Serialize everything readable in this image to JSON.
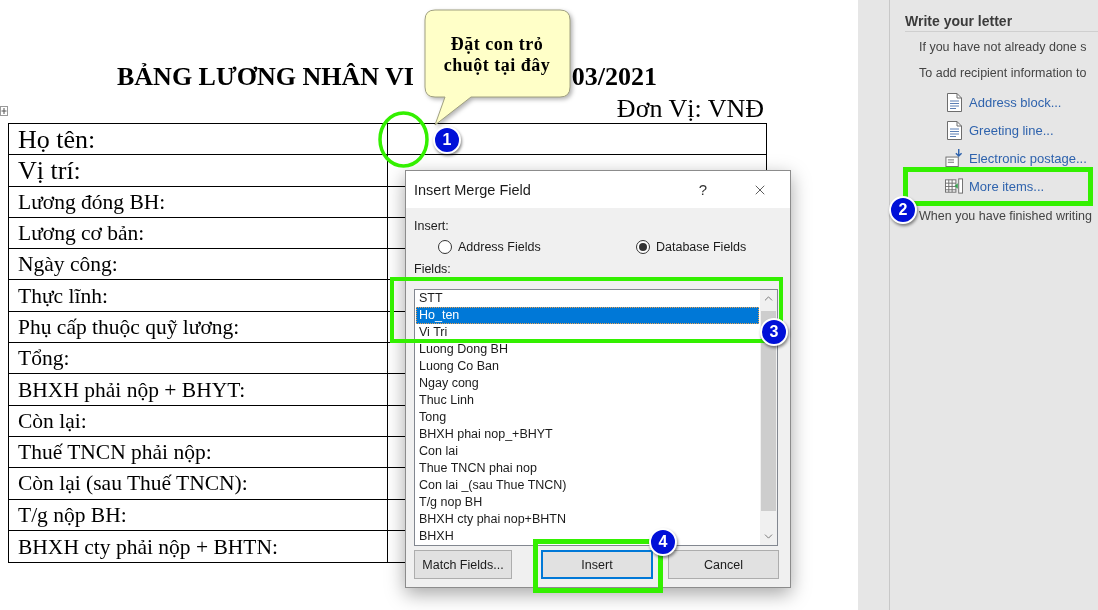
{
  "document": {
    "title_parts": [
      "BẢNG LƯƠNG NHÂN VI",
      "03/2021"
    ],
    "unit": "Đơn Vị: VNĐ",
    "rows": [
      {
        "label": "Họ tên:",
        "kind": "large"
      },
      {
        "label": "Vị trí:",
        "kind": "large"
      },
      {
        "label": "Lương đóng BH:",
        "kind": "normal"
      },
      {
        "label": "Lương cơ bản:",
        "kind": "normal"
      },
      {
        "label": "Ngày công:",
        "kind": "normal"
      },
      {
        "label": "Thực lĩnh:",
        "kind": "normal"
      },
      {
        "label": "Phụ cấp thuộc quỹ lương:",
        "kind": "normal"
      },
      {
        "label": "Tổng:",
        "kind": "normal"
      },
      {
        "label": "BHXH phải nộp + BHYT:",
        "kind": "normal"
      },
      {
        "label": "Còn lại:",
        "kind": "normal"
      },
      {
        "label": "Thuế TNCN phải nộp:",
        "kind": "normal"
      },
      {
        "label": "Còn lại (sau Thuế TNCN):",
        "kind": "normal"
      },
      {
        "label": "T/g nộp BH:",
        "kind": "normal"
      },
      {
        "label": "BHXH cty phải nộp + BHTN:",
        "kind": "normal"
      }
    ]
  },
  "callout": {
    "text": "Đặt con trỏ chuột tại đây"
  },
  "dialog": {
    "title": "Insert Merge Field",
    "help": "?",
    "insert_label": "Insert:",
    "insert_options": [
      {
        "label": "Address Fields",
        "selected": false
      },
      {
        "label": "Database Fields",
        "selected": true
      }
    ],
    "fields_label": "Fields:",
    "fields": [
      {
        "label": "STT",
        "selected": false
      },
      {
        "label": "Ho_ten",
        "selected": true
      },
      {
        "label": "Vi Tri",
        "selected": false
      },
      {
        "label": "Luong Dong BH",
        "selected": false
      },
      {
        "label": "Luong Co Ban",
        "selected": false
      },
      {
        "label": "Ngay cong",
        "selected": false
      },
      {
        "label": "Thuc Linh",
        "selected": false
      },
      {
        "label": "Tong",
        "selected": false
      },
      {
        "label": "BHXH phai nop_+BHYT",
        "selected": false
      },
      {
        "label": "Con lai",
        "selected": false
      },
      {
        "label": "Thue TNCN phai nop",
        "selected": false
      },
      {
        "label": "Con lai _(sau Thue TNCN)",
        "selected": false
      },
      {
        "label": "T/g nop BH",
        "selected": false
      },
      {
        "label": "BHXH cty phai nop+BHTN",
        "selected": false
      },
      {
        "label": "BHXH",
        "selected": false
      }
    ],
    "buttons": [
      {
        "label": "Match Fields...",
        "focused": false
      },
      {
        "label": "Insert",
        "focused": true
      },
      {
        "label": "Cancel",
        "focused": false
      }
    ]
  },
  "task_pane": {
    "heading": "Write your letter",
    "paragraphs": [
      "If you have not already done s",
      "To add recipient information to"
    ],
    "links": [
      {
        "kind": "document",
        "label": "Address block..."
      },
      {
        "kind": "document",
        "label": "Greeting line..."
      },
      {
        "kind": "postage",
        "label": "Electronic postage..."
      },
      {
        "kind": "table",
        "label": "More items..."
      }
    ],
    "footer": "When you have finished writing"
  },
  "step_markers": [
    "1",
    "2",
    "3",
    "4"
  ]
}
